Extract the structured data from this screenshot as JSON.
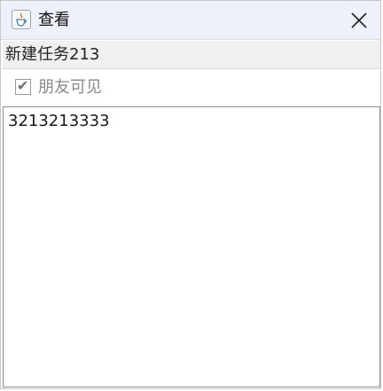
{
  "window": {
    "title": "查看",
    "app_icon": "java-cup-icon",
    "close_icon": "close-icon"
  },
  "task": {
    "name": "新建任务213"
  },
  "visibility": {
    "label": "朋友可见",
    "checked": true,
    "enabled": false
  },
  "content": {
    "text": "3213213333"
  },
  "colors": {
    "titlebar_bg": "#eef1f9",
    "task_bg": "#f0f0f0",
    "disabled_text": "#8a8a8a",
    "border": "#8e8e8e"
  }
}
